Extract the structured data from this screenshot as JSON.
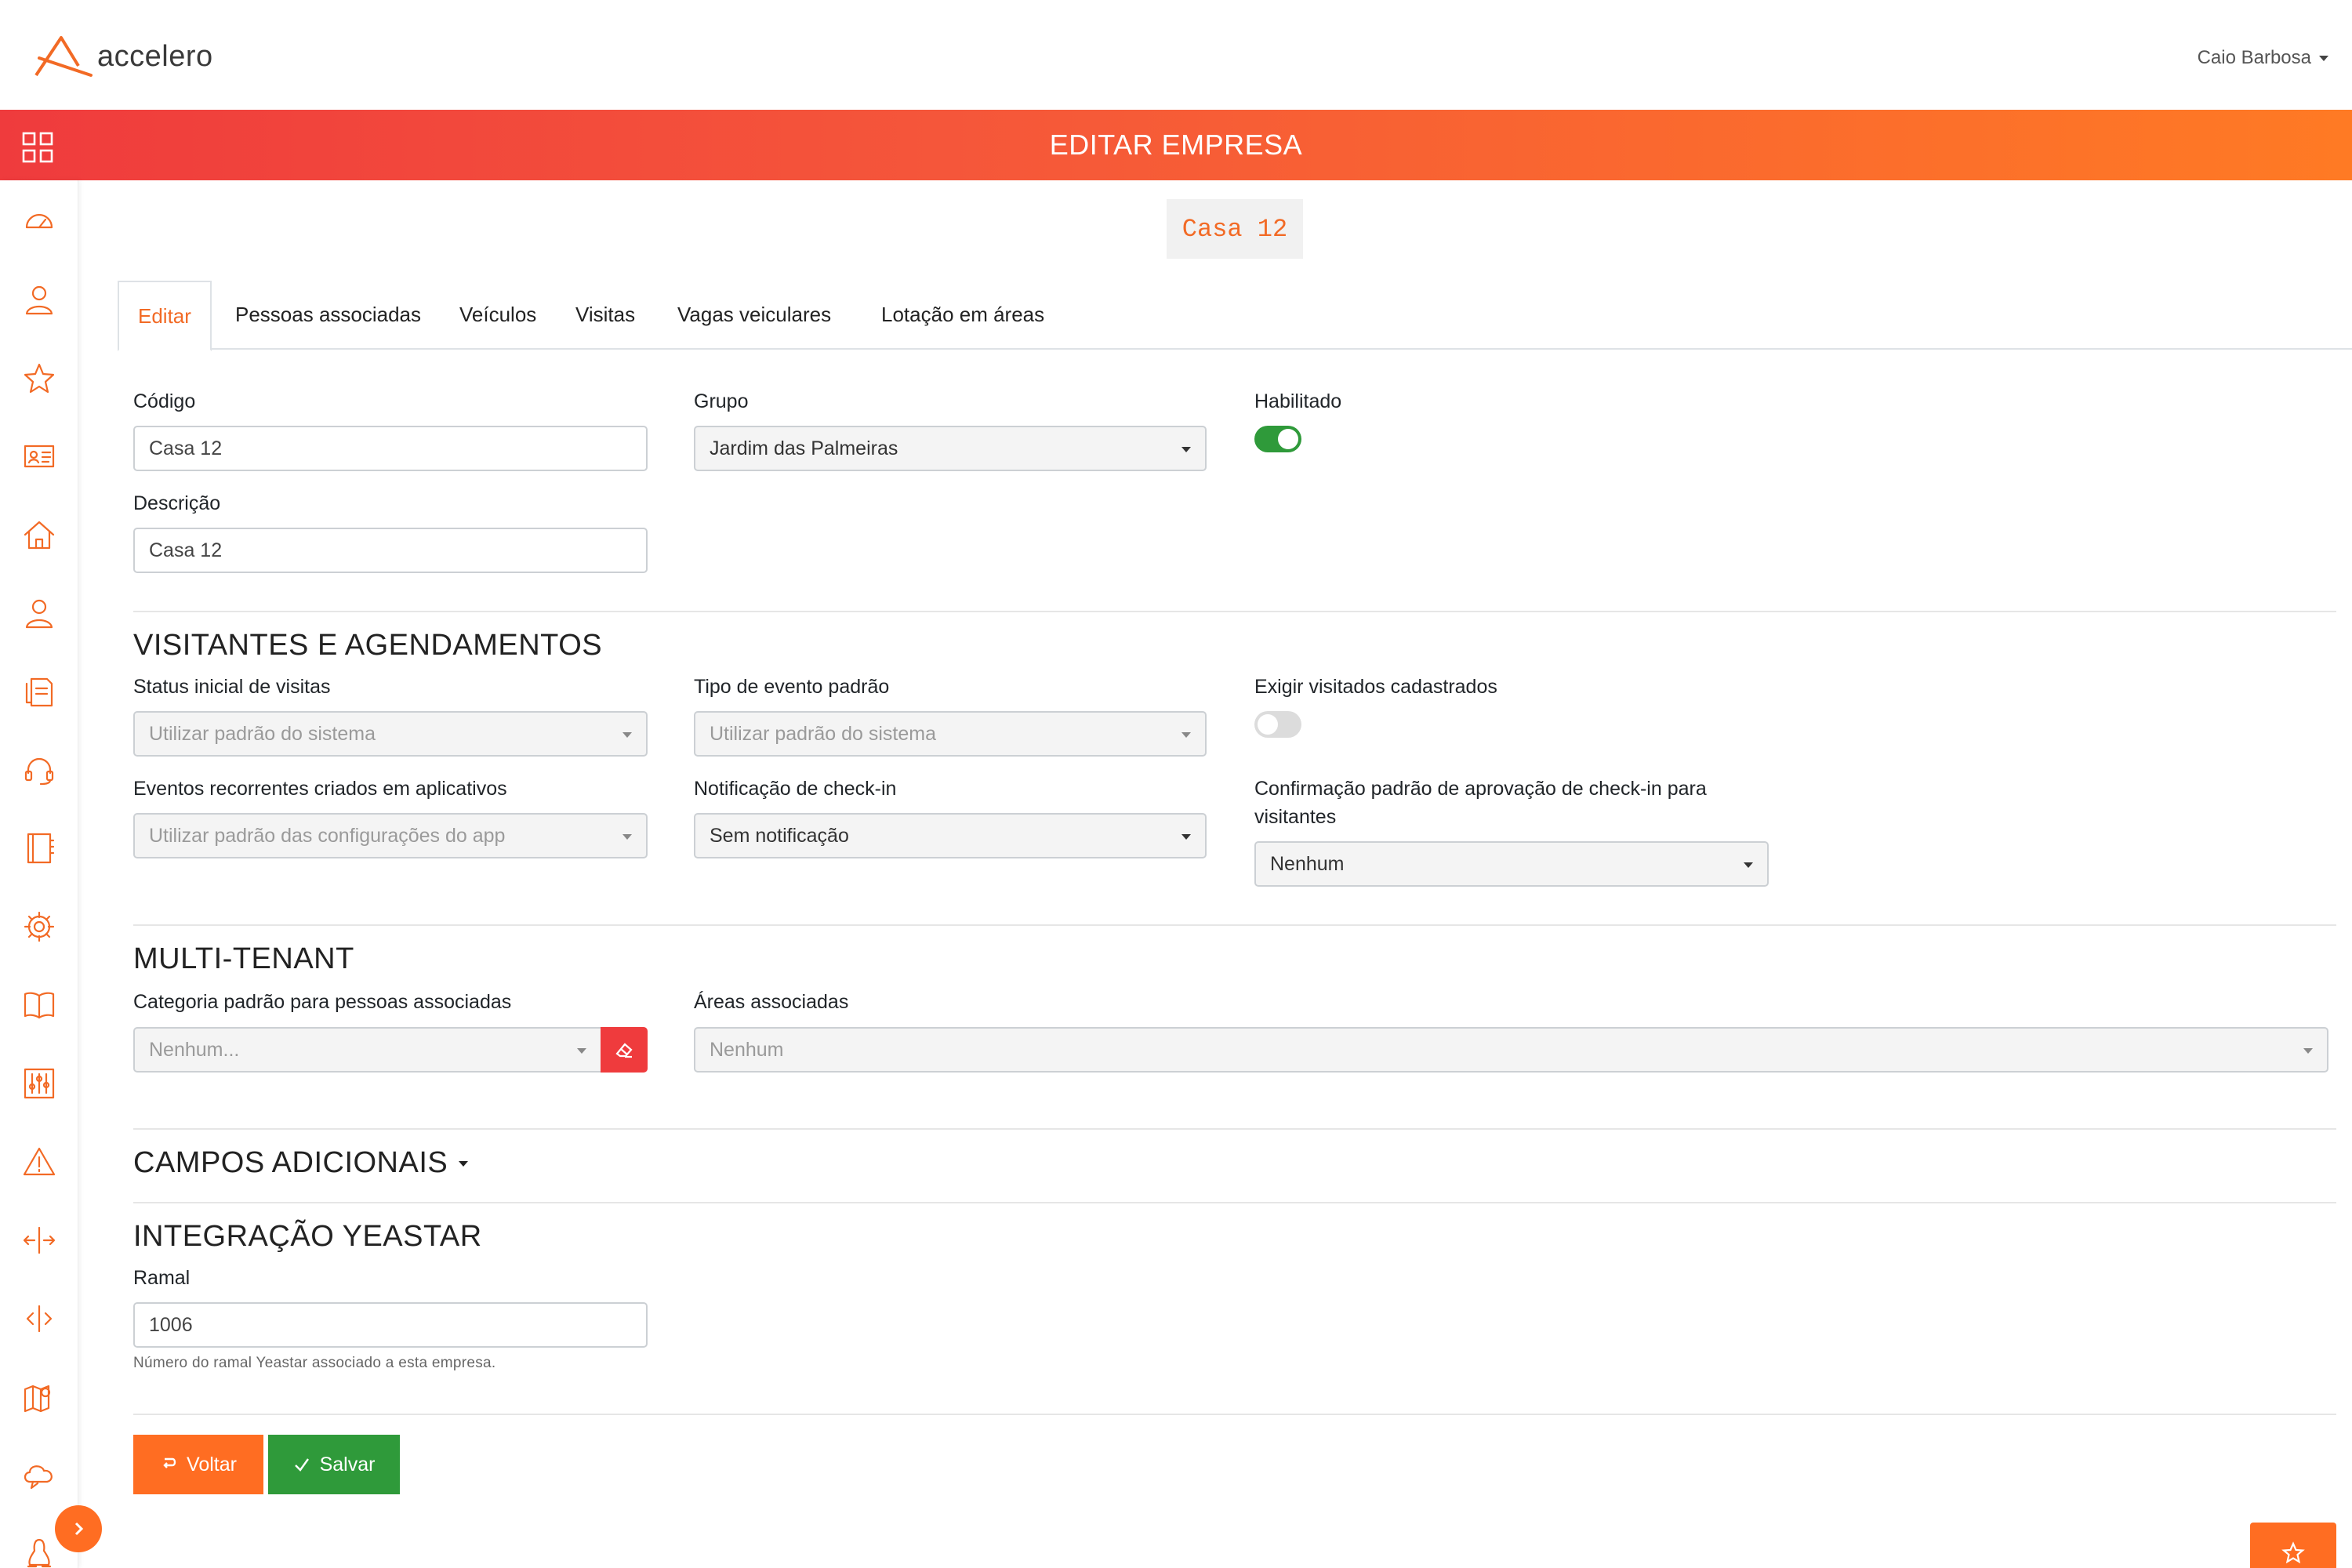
{
  "app": {
    "logo_text": "accelero",
    "user_name": "Caio Barbosa"
  },
  "header": {
    "title": "EDITAR EMPRESA"
  },
  "record_badge": "Casa 12",
  "tabs": [
    {
      "label": "Editar",
      "active": true
    },
    {
      "label": "Pessoas associadas"
    },
    {
      "label": "Veículos"
    },
    {
      "label": "Visitas"
    },
    {
      "label": "Vagas veiculares"
    },
    {
      "label": "Lotação em áreas"
    }
  ],
  "sidebar": {
    "icons": [
      "dashboard-icon",
      "user-icon",
      "star-icon",
      "id-card-icon",
      "home-icon",
      "person-icon",
      "documents-icon",
      "headset-icon",
      "notebook-icon",
      "gear-icon",
      "book-icon",
      "sliders-icon",
      "warning-icon",
      "arrows-split-icon",
      "code-split-icon",
      "map-pin-icon",
      "cloud-chat-icon",
      "linux-icon"
    ]
  },
  "form": {
    "codigo": {
      "label": "Código",
      "value": "Casa 12"
    },
    "grupo": {
      "label": "Grupo",
      "value": "Jardim das Palmeiras"
    },
    "habilitado": {
      "label": "Habilitado",
      "checked": true
    },
    "descricao": {
      "label": "Descrição",
      "value": "Casa 12"
    }
  },
  "visitantes": {
    "title": "VISITANTES E AGENDAMENTOS",
    "status_inicial": {
      "label": "Status inicial de visitas",
      "value": "Utilizar padrão do sistema"
    },
    "tipo_evento": {
      "label": "Tipo de evento padrão",
      "value": "Utilizar padrão do sistema"
    },
    "exigir_visitados": {
      "label": "Exigir visitados cadastrados",
      "checked": false
    },
    "eventos_recorrentes": {
      "label": "Eventos recorrentes criados em aplicativos",
      "value": "Utilizar padrão das configurações do app"
    },
    "notificacao_checkin": {
      "label": "Notificação de check-in",
      "value": "Sem notificação"
    },
    "confirmacao": {
      "label_line1": "Confirmação padrão de aprovação de check-in para",
      "label_line2": "visitantes",
      "value": "Nenhum"
    }
  },
  "multitenant": {
    "title": "MULTI-TENANT",
    "categoria": {
      "label": "Categoria padrão para pessoas associadas",
      "placeholder": "Nenhum..."
    },
    "areas": {
      "label": "Áreas associadas",
      "placeholder": "Nenhum"
    }
  },
  "campos_adicionais": {
    "title": "CAMPOS ADICIONAIS"
  },
  "yeastar": {
    "title": "INTEGRAÇÃO YEASTAR",
    "ramal": {
      "label": "Ramal",
      "value": "1006",
      "help": "Número do ramal Yeastar associado a esta empresa."
    }
  },
  "actions": {
    "back_label": "Voltar",
    "save_label": "Salvar"
  },
  "colors": {
    "accent": "#ff6d22",
    "header_start": "#ef3b3d",
    "header_end": "#ff7a24",
    "success": "#2f9a3a",
    "danger": "#ef3b3d"
  }
}
